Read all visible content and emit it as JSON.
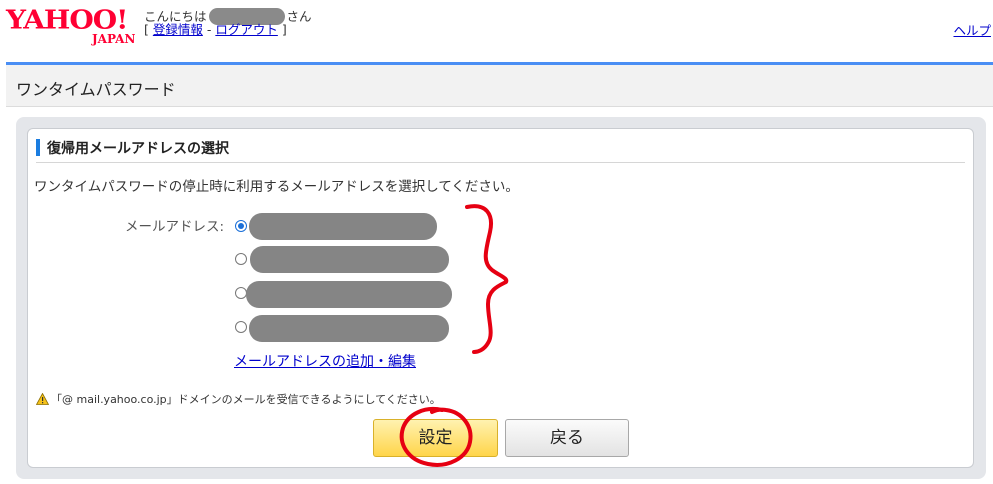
{
  "header": {
    "logo_text": "YAHOO!",
    "logo_sub": "JAPAN",
    "greeting_prefix": "こんにちは",
    "greeting_suffix": "さん",
    "links_open": "[ ",
    "register_info": "登録情報",
    "separator": " - ",
    "logout": "ログアウト",
    "links_close": " ]",
    "help": "ヘルプ"
  },
  "page": {
    "title": "ワンタイムパスワード"
  },
  "section": {
    "title": "復帰用メールアドレスの選択",
    "description": "ワンタイムパスワードの停止時に利用するメールアドレスを選択してください。",
    "email_label": "メールアドレス:",
    "emails": [
      {
        "selected": true
      },
      {
        "selected": false
      },
      {
        "selected": false
      },
      {
        "selected": false
      }
    ],
    "edit_link": "メールアドレスの追加・編集",
    "notice": "「@ mail.yahoo.co.jp」ドメインのメールを受信できるようにしてください。"
  },
  "buttons": {
    "submit": "設定",
    "back": "戻る"
  },
  "colors": {
    "brand": "#ff0033",
    "accent": "#4a8ef4",
    "annotation": "#e60012"
  },
  "icons": {
    "notice": "warning-icon"
  }
}
